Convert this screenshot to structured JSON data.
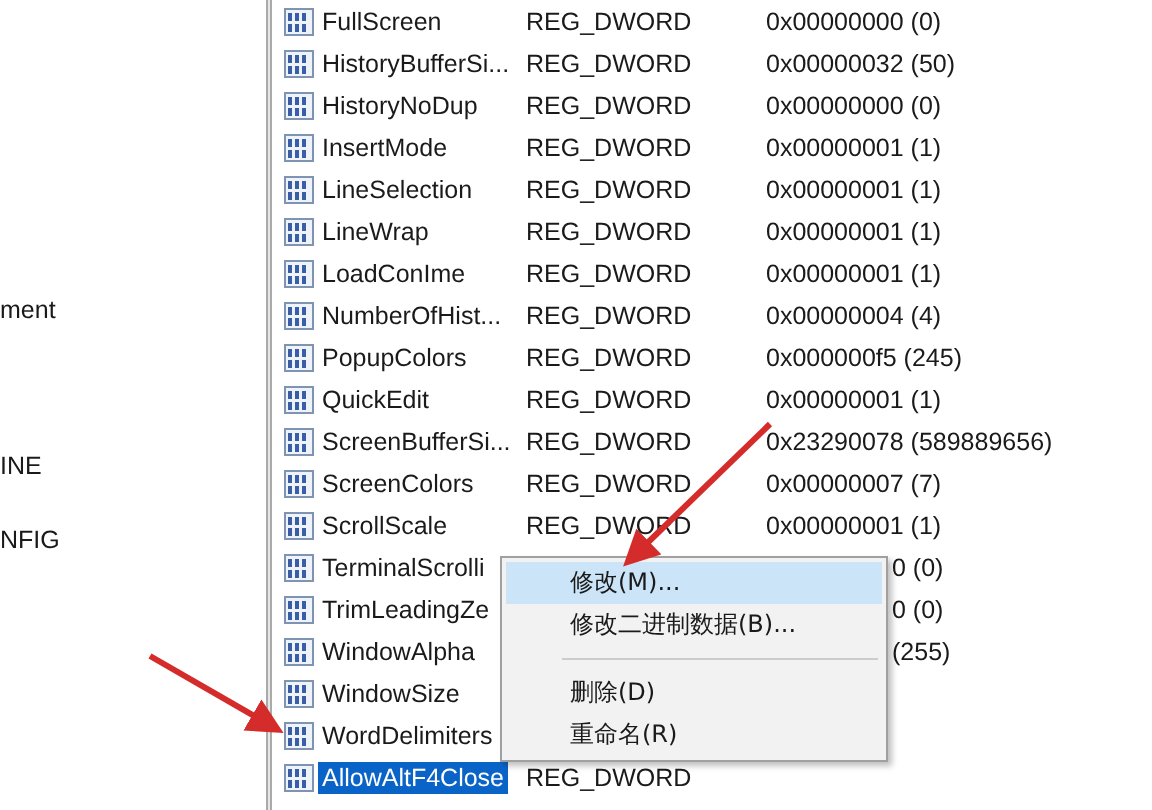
{
  "tree": {
    "items": [
      {
        "label": "ment"
      },
      {
        "label": "INE"
      },
      {
        "label": "NFIG"
      }
    ]
  },
  "values": [
    {
      "name": "FullScreen",
      "type": "REG_DWORD",
      "data": "0x00000000 (0)",
      "selected": false,
      "covered": false
    },
    {
      "name": "HistoryBufferSi...",
      "type": "REG_DWORD",
      "data": "0x00000032 (50)",
      "selected": false,
      "covered": false
    },
    {
      "name": "HistoryNoDup",
      "type": "REG_DWORD",
      "data": "0x00000000 (0)",
      "selected": false,
      "covered": false
    },
    {
      "name": "InsertMode",
      "type": "REG_DWORD",
      "data": "0x00000001 (1)",
      "selected": false,
      "covered": false
    },
    {
      "name": "LineSelection",
      "type": "REG_DWORD",
      "data": "0x00000001 (1)",
      "selected": false,
      "covered": false
    },
    {
      "name": "LineWrap",
      "type": "REG_DWORD",
      "data": "0x00000001 (1)",
      "selected": false,
      "covered": false
    },
    {
      "name": "LoadConIme",
      "type": "REG_DWORD",
      "data": "0x00000001 (1)",
      "selected": false,
      "covered": false
    },
    {
      "name": "NumberOfHist...",
      "type": "REG_DWORD",
      "data": "0x00000004 (4)",
      "selected": false,
      "covered": false
    },
    {
      "name": "PopupColors",
      "type": "REG_DWORD",
      "data": "0x000000f5 (245)",
      "selected": false,
      "covered": false
    },
    {
      "name": "QuickEdit",
      "type": "REG_DWORD",
      "data": "0x00000001 (1)",
      "selected": false,
      "covered": false
    },
    {
      "name": "ScreenBufferSi...",
      "type": "REG_DWORD",
      "data": "0x23290078 (589889656)",
      "selected": false,
      "covered": false
    },
    {
      "name": "ScreenColors",
      "type": "REG_DWORD",
      "data": "0x00000007 (7)",
      "selected": false,
      "covered": false
    },
    {
      "name": "ScrollScale",
      "type": "REG_DWORD",
      "data": "0x00000001 (1)",
      "selected": false,
      "covered": false
    },
    {
      "name": "TerminalScrolli",
      "data": "0 (0)",
      "selected": false,
      "covered": true
    },
    {
      "name": "TrimLeadingZe",
      "data": "0 (0)",
      "selected": false,
      "covered": true
    },
    {
      "name": "WindowAlpha",
      "data": "(255)",
      "selected": false,
      "covered": true
    },
    {
      "name": "WindowSize",
      "selected": false
    },
    {
      "name": "WordDelimiters",
      "selected": false
    },
    {
      "name": "AllowAltF4Close",
      "type": "REG_DWORD",
      "selected": true,
      "covered": false
    }
  ],
  "context_menu": {
    "items": [
      {
        "kind": "item",
        "label": "修改(M)...",
        "selected": true
      },
      {
        "kind": "item",
        "label": "修改二进制数据(B)...",
        "selected": false
      },
      {
        "kind": "separator"
      },
      {
        "kind": "item",
        "label": "删除(D)",
        "selected": false
      },
      {
        "kind": "item",
        "label": "重命名(R)",
        "selected": false
      }
    ]
  }
}
